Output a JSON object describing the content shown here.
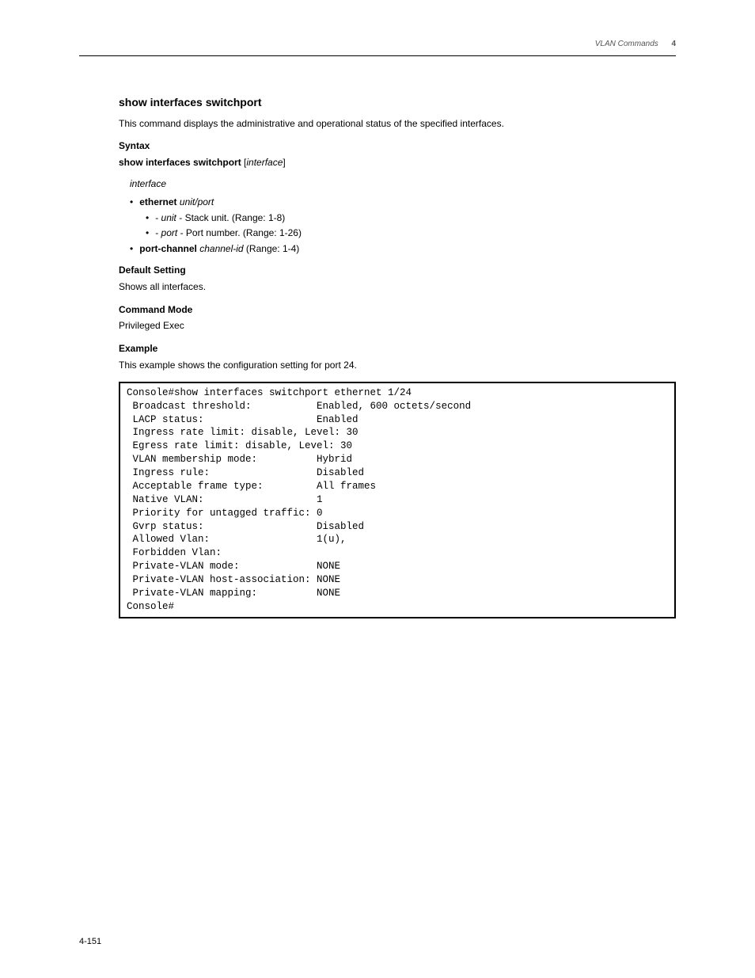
{
  "header": {
    "left": "",
    "right": "VLAN Commands",
    "section_number": "4"
  },
  "section": {
    "title": "show interfaces switchport",
    "desc": "This command displays the administrative and operational status of the specified interfaces."
  },
  "syntax": {
    "label": "Syntax",
    "line_prefix": "show interfaces switchport",
    "line_suffix": "interface",
    "params_label": "interface",
    "bullets": [
      {
        "cmd": "ethernet",
        "param": "unit/port",
        "tail": ""
      },
      {
        "indent": true,
        "param": "unit",
        "tail": " - Stack unit. (Range: 1-8)"
      },
      {
        "indent": true,
        "param": "port",
        "tail": " - Port number. (Range: 1-26)"
      },
      {
        "cmd": "port-channel",
        "param": "channel-id",
        "tail": " (Range: 1-4)"
      }
    ]
  },
  "default": {
    "label": "Default Setting",
    "value": "Shows all interfaces."
  },
  "mode": {
    "label": "Command Mode",
    "value": "Privileged Exec"
  },
  "example": {
    "label": "Example",
    "intro": "This example shows the configuration setting for port 24.",
    "console": "Console#show interfaces switchport ethernet 1/24\n Broadcast threshold:           Enabled, 600 octets/second\n LACP status:                   Enabled\n Ingress rate limit: disable, Level: 30\n Egress rate limit: disable, Level: 30\n VLAN membership mode:          Hybrid\n Ingress rule:                  Disabled\n Acceptable frame type:         All frames\n Native VLAN:                   1\n Priority for untagged traffic: 0\n Gvrp status:                   Disabled\n Allowed Vlan:                  1(u),\n Forbidden Vlan:\n Private-VLAN mode:             NONE\n Private-VLAN host-association: NONE\n Private-VLAN mapping:          NONE\nConsole#"
  },
  "page_number": "4-151"
}
